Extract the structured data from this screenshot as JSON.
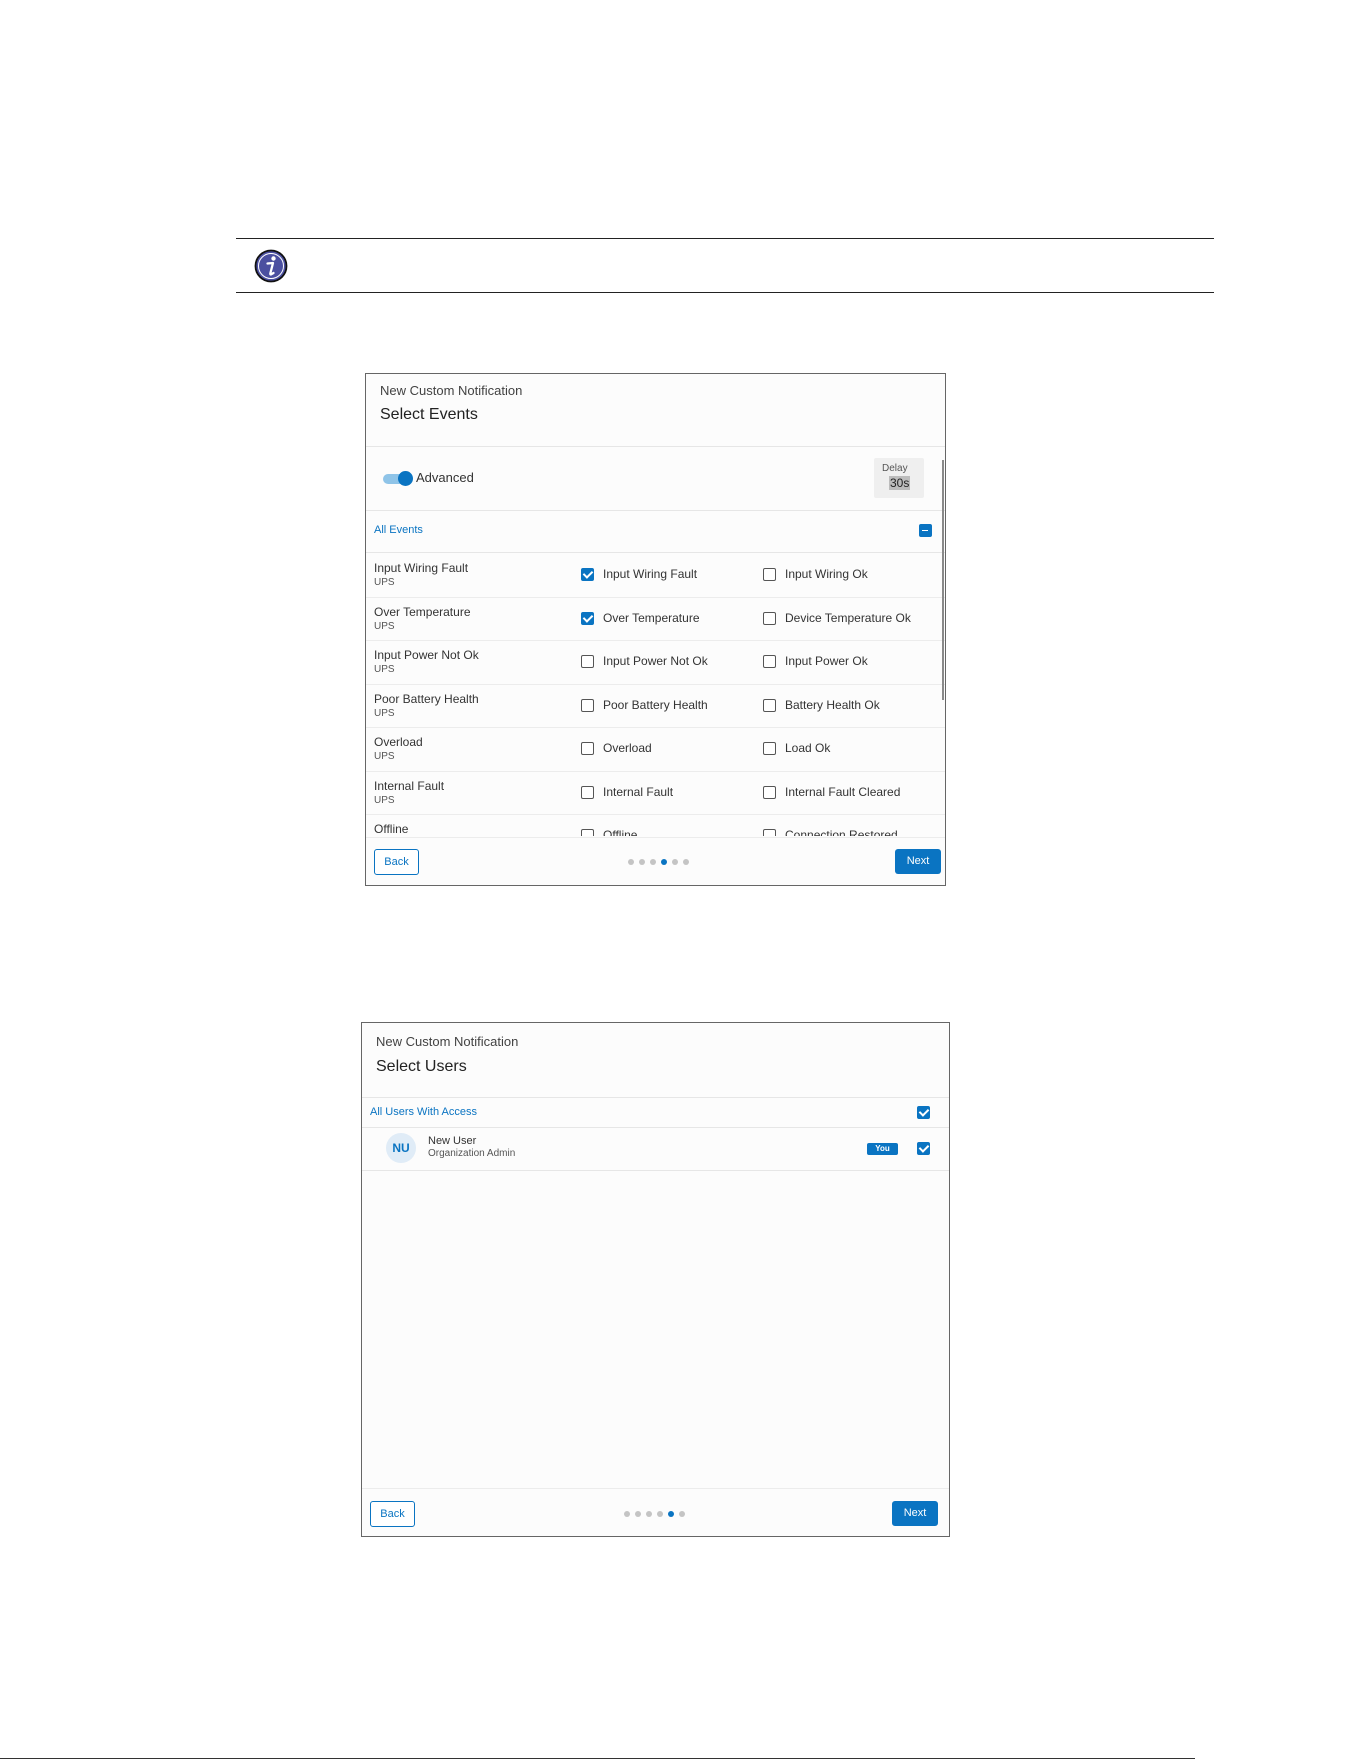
{
  "select_events_dialog": {
    "subtitle": "New Custom Notification",
    "title": "Select Events",
    "advanced_label": "Advanced",
    "advanced_on": true,
    "delay": {
      "label": "Delay",
      "value": "30s"
    },
    "all_events_label": "All Events",
    "all_events_state": "indeterminate",
    "rows": [
      {
        "title": "Input Wiring Fault",
        "device": "UPS",
        "option_a": {
          "label": "Input Wiring Fault",
          "checked": true
        },
        "option_b": {
          "label": "Input Wiring Ok",
          "checked": false
        }
      },
      {
        "title": "Over Temperature",
        "device": "UPS",
        "option_a": {
          "label": "Over Temperature",
          "checked": true
        },
        "option_b": {
          "label": "Device Temperature Ok",
          "checked": false
        }
      },
      {
        "title": "Input Power Not Ok",
        "device": "UPS",
        "option_a": {
          "label": "Input Power Not Ok",
          "checked": false
        },
        "option_b": {
          "label": "Input Power Ok",
          "checked": false
        }
      },
      {
        "title": "Poor Battery Health",
        "device": "UPS",
        "option_a": {
          "label": "Poor Battery Health",
          "checked": false
        },
        "option_b": {
          "label": "Battery Health Ok",
          "checked": false
        }
      },
      {
        "title": "Overload",
        "device": "UPS",
        "option_a": {
          "label": "Overload",
          "checked": false
        },
        "option_b": {
          "label": "Load Ok",
          "checked": false
        }
      },
      {
        "title": "Internal Fault",
        "device": "UPS",
        "option_a": {
          "label": "Internal Fault",
          "checked": false
        },
        "option_b": {
          "label": "Internal Fault Cleared",
          "checked": false
        }
      },
      {
        "title": "Offline",
        "device": "",
        "option_a": {
          "label": "Offline",
          "checked": false
        },
        "option_b": {
          "label": "Connection Restored",
          "checked": false
        }
      }
    ],
    "back_label": "Back",
    "next_label": "Next",
    "steps_total": 6,
    "step_current": 4
  },
  "select_users_dialog": {
    "subtitle": "New Custom Notification",
    "title": "Select Users",
    "all_users_label": "All Users With Access",
    "all_users_checked": true,
    "users": [
      {
        "initials": "NU",
        "name": "New User",
        "role": "Organization Admin",
        "badge": "You",
        "checked": true
      }
    ],
    "back_label": "Back",
    "next_label": "Next",
    "steps_total": 6,
    "step_current": 5
  },
  "icons": {
    "note": "info-icon"
  },
  "colors": {
    "accent": "#0a74c2",
    "info_icon_fill": "#4b4fa0"
  }
}
